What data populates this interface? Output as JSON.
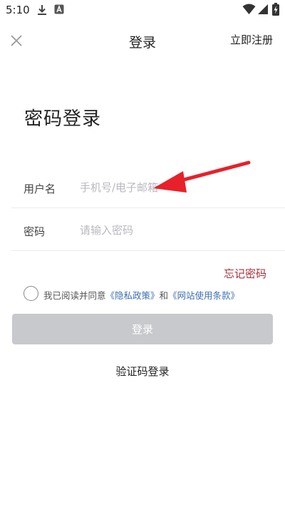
{
  "status_bar": {
    "time": "5:10",
    "icons": [
      "download-icon",
      "a-badge-icon",
      "wifi-icon",
      "signal-icon",
      "battery-charging-icon"
    ]
  },
  "nav": {
    "title": "登录",
    "close_icon": "close-icon",
    "register_label": "立即注册"
  },
  "page_heading": "密码登录",
  "form": {
    "username": {
      "label": "用户名",
      "placeholder": "手机号/电子邮箱",
      "value": ""
    },
    "password": {
      "label": "密码",
      "placeholder": "请输入密码",
      "value": ""
    }
  },
  "forgot_password": "忘记密码",
  "agreement": {
    "checked": false,
    "prefix": "我已阅读并同意",
    "privacy_policy": "《隐私政策》",
    "connector": "和",
    "terms": "《网站使用条款》"
  },
  "login_button": "登录",
  "alternate_login": "验证码登录",
  "annotation": {
    "type": "arrow",
    "color": "#e8202a",
    "target": "username-input"
  },
  "colors": {
    "forgot_link": "#a8323a",
    "policy_link": "#3c6fb4",
    "button_disabled_bg": "#c8c9cc",
    "divider": "#ececec"
  }
}
